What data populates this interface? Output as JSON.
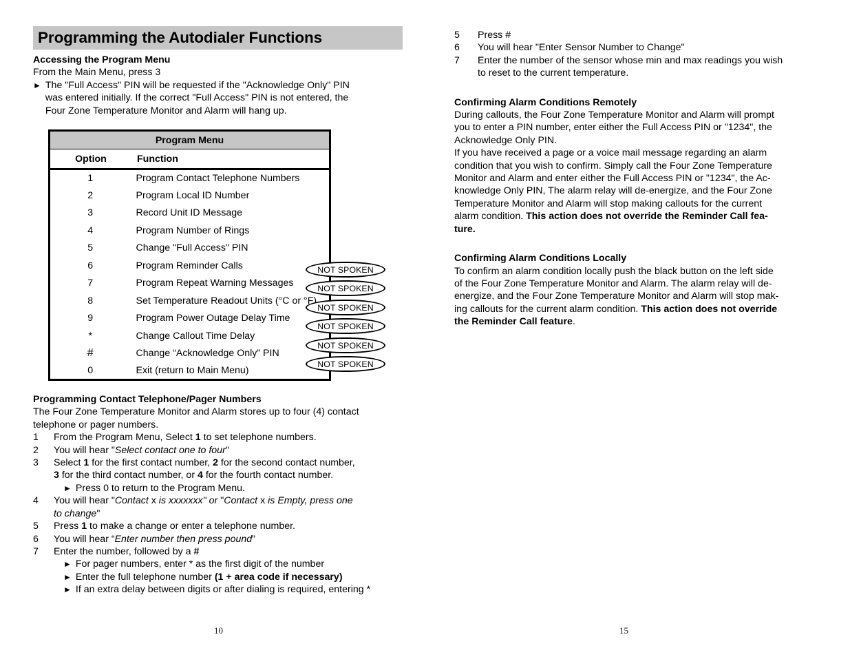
{
  "document": {
    "title": "Programming the Autodialer Functions",
    "page_number_left": "10",
    "page_number_right": "15",
    "header_bg": "#c6c6c6"
  },
  "left_column": {
    "section1": {
      "heading": "Accessing the Program Menu",
      "line1": "From the Main Menu, press 3",
      "bullet1_part1": "The \"Full Access\" PIN will be requested if the \"Acknowledge Only\" PIN",
      "bullet1_part2": "was entered initially.  If the correct \"Full Access\" PIN is not entered, the",
      "bullet1_part3": "Four Zone Temperature Monitor and Alarm will hang up."
    },
    "program_menu_table": {
      "title": "Program Menu",
      "col_option": "Option",
      "col_function": "Function",
      "rows": [
        {
          "option": "1",
          "function": "Program Contact Telephone Numbers",
          "not_spoken": false
        },
        {
          "option": "2",
          "function": "Program Local ID Number",
          "not_spoken": false
        },
        {
          "option": "3",
          "function": "Record Unit ID Message",
          "not_spoken": false
        },
        {
          "option": "4",
          "function": "Program Number of Rings",
          "not_spoken": false
        },
        {
          "option": "5",
          "function": "Change \"Full Access\" PIN",
          "not_spoken": false
        },
        {
          "option": "6",
          "function": "Program Reminder Calls",
          "not_spoken": true
        },
        {
          "option": "7",
          "function": "Program Repeat Warning Messages",
          "not_spoken": true
        },
        {
          "option": "8",
          "function": "Set Temperature Readout Units (°C or °F)",
          "not_spoken": true
        },
        {
          "option": "9",
          "function": "Program Power Outage Delay Time",
          "not_spoken": true
        },
        {
          "option": "*",
          "function": "Change Callout Time Delay",
          "not_spoken": true
        },
        {
          "option": "#",
          "function": "Change “Acknowledge Only” PIN",
          "not_spoken": true
        },
        {
          "option": "0",
          "function": "Exit (return to Main Menu)",
          "not_spoken": false
        }
      ],
      "annotation_label": "NOT SPOKEN"
    },
    "section2": {
      "heading": "Programming Contact Telephone/Pager Numbers",
      "intro_line1": "The Four Zone Temperature Monitor and Alarm stores up to four (4) contact",
      "intro_line2": "telephone or pager numbers.",
      "steps": [
        {
          "num": "1",
          "pre": "From the Program Menu, Select ",
          "bold": "1",
          "post": " to set telephone numbers."
        },
        {
          "num": "2",
          "pre": "You will hear \"",
          "italic": "Select contact one to four",
          "post": "\""
        },
        {
          "num": "3",
          "pre": "Select ",
          "bold": "1",
          "post": " for the first contact number, ",
          "bold2": "2",
          "post2": " for the second contact number,"
        },
        {
          "num": "5",
          "pre": "Press ",
          "bold": "1",
          "post": " to make a change or enter a telephone number."
        },
        {
          "num": "6",
          "pre": "You will hear “",
          "italic": "Enter number then press pound",
          "post": "”"
        },
        {
          "num": "7",
          "pre": "Enter the number, followed by a ",
          "bold": "#",
          "post": ""
        }
      ],
      "step3_line2_bold": "3",
      "step3_line2_a": " for the third contact number, or ",
      "step3_line2_bold2": "4",
      "step3_line2_b": " for the fourth contact number.",
      "step3_bullet": "Press 0 to return to the Program Menu.",
      "step4_num": "4",
      "step4_a": "You will hear \"",
      "step4_i1": "Contact",
      "step4_b": " x ",
      "step4_i2": "is xxxxxxx\"",
      "step4_i3": " or ",
      "step4_c": "\"",
      "step4_i4": "Contact",
      "step4_d": " x ",
      "step4_i5": "is Empty, press one",
      "step4_line2_i": "to change",
      "step4_line2_close": "\"",
      "step7_bullets": [
        {
          "text": "For pager numbers, enter * as the first digit of the number",
          "bold_tail": ""
        },
        {
          "text": "Enter the full telephone number ",
          "bold_tail": "(1 + area code if necessary)"
        },
        {
          "text": "If an extra delay between digits or after dialing is required, entering *",
          "bold_tail": ""
        }
      ]
    }
  },
  "right_column": {
    "steps_continued": [
      {
        "num": "5",
        "text": "Press #"
      },
      {
        "num": "6",
        "text": "You will hear \"Enter Sensor Number to Change\""
      },
      {
        "num": "7",
        "text": "Enter the number of the sensor whose min and max readings you wish"
      }
    ],
    "step7_line2": "to reset to the current temperature.",
    "section_remote": {
      "heading": "Confirming Alarm Conditions Remotely",
      "p1_line1": "During callouts, the Four Zone Temperature Monitor and Alarm will prompt",
      "p1_line2": "you to enter a PIN number, enter either the Full Access PIN or \"1234\", the",
      "p1_line3": "Acknowledge Only PIN.",
      "p2_line1": "If you have received a page or a voice mail message regarding an alarm",
      "p2_line2": "condition that you wish to confirm.  Simply call the Four Zone Temperature",
      "p2_line3": "Monitor and Alarm and enter either the Full Access PIN or \"1234\", the Ac-",
      "p2_line4": "knowledge Only PIN,  The alarm relay will de-energize, and the Four Zone",
      "p2_line5": "Temperature Monitor and Alarm will stop making callouts for the current",
      "p2_line6_normal": "alarm condition.  ",
      "p2_line6_bold": "This action does not override the Reminder Call fea-",
      "p2_line7_bold": "ture."
    },
    "section_local": {
      "heading": "Confirming Alarm Conditions Locally",
      "p1_line1": "To confirm an alarm condition locally push the black button on the left side",
      "p1_line2": "of the Four Zone Temperature Monitor and Alarm. The alarm relay will de-",
      "p1_line3": "energize, and the Four Zone Temperature Monitor and Alarm will stop mak-",
      "p1_line4_normal": "ing callouts for the current alarm condition.  ",
      "p1_line4_bold": "This action does not override",
      "p1_line5_bold": "the Reminder Call feature",
      "p1_line5_tail": "."
    }
  }
}
